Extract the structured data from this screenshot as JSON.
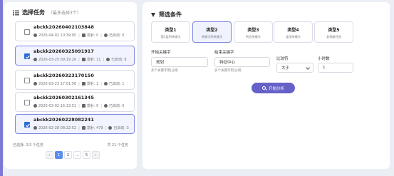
{
  "task_panel": {
    "title": "选择任务",
    "subtitle": "（最多选择3个）",
    "tasks": [
      {
        "id": "abckk20260402103848",
        "time": "2026-04-02 10:39:05",
        "sender_label": "发射: 0",
        "started_label": "已启动: 0",
        "selected": false
      },
      {
        "id": "abckk20260325091917",
        "time": "2026-03-25 09:19:26",
        "sender_label": "发射: 11",
        "started_label": "已启动: 8",
        "selected": true
      },
      {
        "id": "abckk20260323170150",
        "time": "2026-03-23 17:01:56",
        "sender_label": "发射: 1",
        "started_label": "已启动: 1",
        "selected": false
      },
      {
        "id": "abckk20260302161345",
        "time": "2026-03-02 16:13:51",
        "sender_label": "发射: 0",
        "started_label": "已启动: 0",
        "selected": false
      },
      {
        "id": "abckk20260228082241",
        "time": "2026-02-28 08:22:52",
        "sender_label": "发射: 479",
        "started_label": "已启动: 3",
        "selected": true
      }
    ],
    "selected_summary": "已选择: 2/3 个任务",
    "total_summary": "共 21 个任务",
    "pagination": {
      "prev": "‹",
      "pages": [
        "1",
        "2",
        "...",
        "5"
      ],
      "next": "›",
      "current": "1"
    }
  },
  "filter_panel": {
    "title": "筛选条件",
    "types": [
      {
        "name": "类型1",
        "desc": "第1层到关键字",
        "active": false
      },
      {
        "name": "类型2",
        "desc": "关键字到关键字",
        "active": true
      },
      {
        "name": "类型3",
        "desc": "到达关键字",
        "active": false
      },
      {
        "name": "类型4",
        "desc": "连续关键字",
        "active": false
      },
      {
        "name": "类型5",
        "desc": "其他路径选",
        "active": false
      }
    ],
    "start_keyword": {
      "label": "开始关键字",
      "value": "规划",
      "hint": "多个关键字用|分隔"
    },
    "end_keyword": {
      "label": "结束关键字",
      "value": "特征中心",
      "hint": "多个关键字用|分隔"
    },
    "operator": {
      "label": "比较符",
      "value": "大于"
    },
    "hours": {
      "label": "小时数",
      "value": "1"
    },
    "start_button": "开始分析"
  },
  "colors": {
    "accent": "#6561c8",
    "selected_border": "#7d86e4",
    "checkbox": "#2b6fd6",
    "page_active": "#5b8def"
  }
}
